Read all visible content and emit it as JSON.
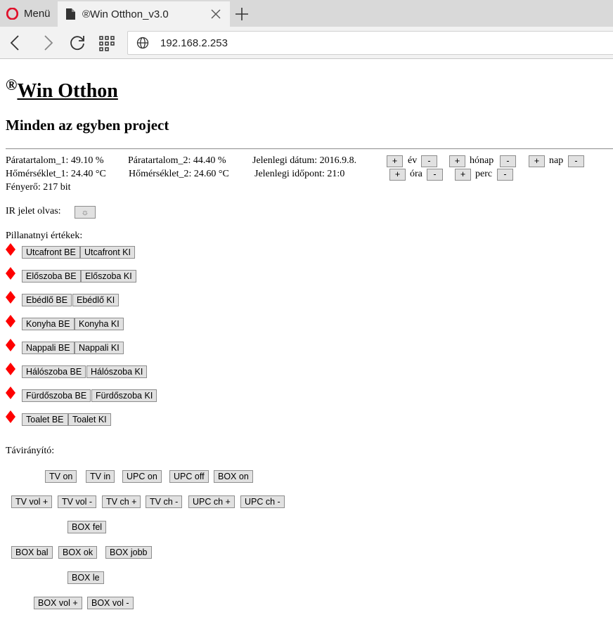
{
  "browser": {
    "menu_label": "Menü",
    "tab_title": "®Win Otthon_v3.0",
    "address": "192.168.2.253"
  },
  "header": {
    "reg_mark": "®",
    "title": "Win Otthon",
    "subtitle": "Minden az egyben project"
  },
  "status": {
    "humidity_1": "Páratartalom_1: 49.10 %",
    "humidity_2": "Páratartalom_2: 44.40 %",
    "date": "Jelenlegi dátum: 2016.9.8.",
    "temp_1": "Hőmérséklet_1: 24.40 °C",
    "temp_2": "Hőmérséklet_2: 24.60 °C",
    "time": "Jelenlegi időpont: 21:0",
    "light": "Fényerő: 217 bit"
  },
  "datetime": {
    "plus": "+",
    "minus": "-",
    "year": "év",
    "month": "hónap",
    "day": "nap",
    "hour": "óra",
    "minute": "perc"
  },
  "ir": {
    "label": "IR jelet olvas:",
    "button": "☼"
  },
  "current": {
    "label": "Pillanatnyi értékek:",
    "rooms": [
      {
        "on": "Utcafront BE",
        "off": "Utcafront KI"
      },
      {
        "on": "Előszoba BE",
        "off": "Előszoba KI"
      },
      {
        "on": "Ebédlő BE",
        "off": "Ebédlő KI"
      },
      {
        "on": "Konyha BE",
        "off": "Konyha KI"
      },
      {
        "on": "Nappali BE",
        "off": "Nappali KI"
      },
      {
        "on": "Hálószoba BE",
        "off": "Hálószoba KI"
      },
      {
        "on": "Fürdőszoba BE",
        "off": "Fürdőszoba KI"
      },
      {
        "on": "Toalet BE",
        "off": "Toalet KI"
      }
    ],
    "indicator_color": "#ff0000"
  },
  "remote": {
    "label": "Távirányító:",
    "row1": [
      "TV on",
      "TV in",
      "UPC on",
      "UPC off",
      "BOX on"
    ],
    "row2": [
      "TV vol +",
      "TV vol -",
      "TV ch +",
      "TV ch -",
      "UPC ch +",
      "UPC ch -"
    ],
    "box_up": "BOX fel",
    "row4": [
      "BOX bal",
      "BOX ok",
      "BOX jobb"
    ],
    "box_down": "BOX le",
    "row6": [
      "BOX vol +",
      "BOX vol -"
    ]
  }
}
